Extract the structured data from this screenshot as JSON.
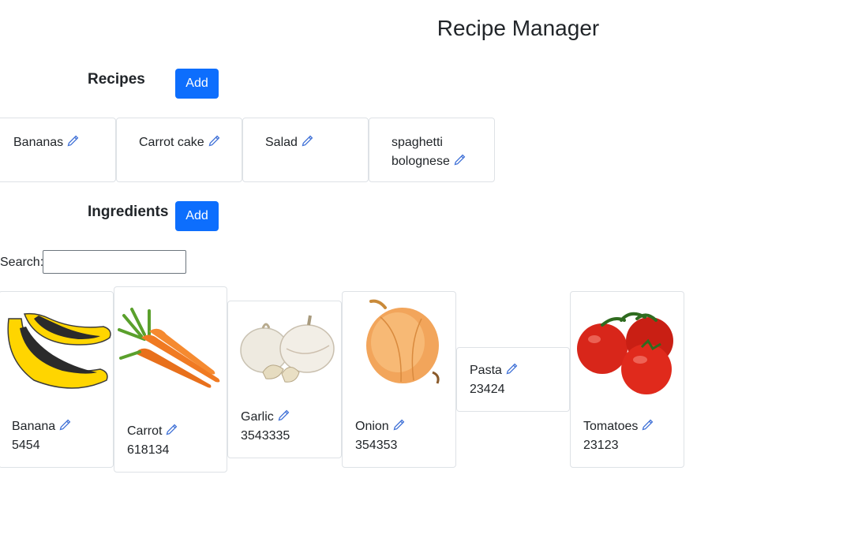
{
  "header": {
    "title": "Recipe Manager"
  },
  "recipes": {
    "heading": "Recipes",
    "add_label": "Add",
    "items": [
      {
        "name": "Bananas"
      },
      {
        "name": "Carrot cake"
      },
      {
        "name": "Salad"
      },
      {
        "name": "spaghetti bolognese"
      }
    ]
  },
  "ingredients": {
    "heading": "Ingredients",
    "add_label": "Add",
    "search_label": "Search:",
    "search_value": "",
    "items": [
      {
        "name": "Banana",
        "qty": "5454"
      },
      {
        "name": "Carrot",
        "qty": "618134"
      },
      {
        "name": "Garlic",
        "qty": "3543335"
      },
      {
        "name": "Onion",
        "qty": "354353"
      },
      {
        "name": "Pasta",
        "qty": "23424"
      },
      {
        "name": "Tomatoes",
        "qty": "23123"
      }
    ]
  },
  "icons": {
    "edit": "pencil-icon"
  },
  "colors": {
    "accent": "#0d6efd",
    "edit_icon": "#3d6fd6"
  }
}
